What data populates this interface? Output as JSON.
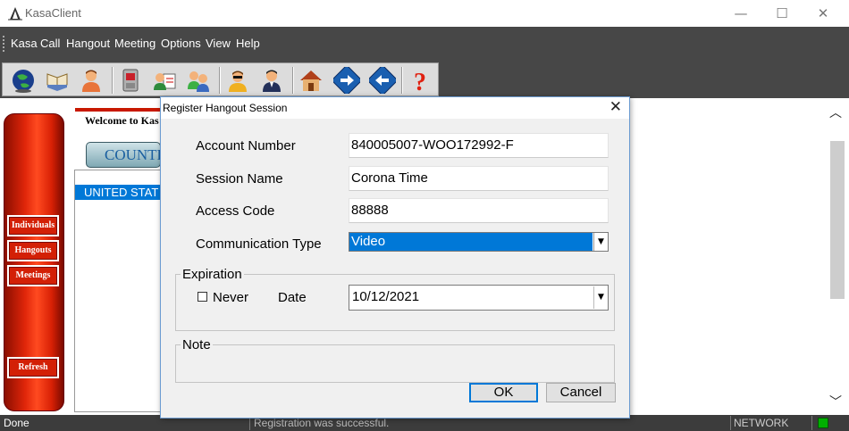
{
  "window": {
    "title": "KasaClient",
    "controls": {
      "minimize": "—",
      "maximize": "☐",
      "close": "✕"
    }
  },
  "menu": {
    "items": [
      "Kasa",
      "Call",
      "Hangout",
      "Meeting",
      "Options",
      "View",
      "Help"
    ]
  },
  "toolbar": {
    "icons": [
      "globe-icon",
      "book-icon",
      "person-icon",
      "phone-icon",
      "contact-icon",
      "group-icon",
      "user-sunglasses-icon",
      "user-suit-icon",
      "home-icon",
      "forward-arrow-icon",
      "back-arrow-icon",
      "help-icon"
    ]
  },
  "sidebar": {
    "buttons": [
      "Individuals",
      "Hangouts",
      "Meetings",
      "Refresh"
    ]
  },
  "main": {
    "welcome": "Welcome to Kas",
    "country_button": "COUNTRY",
    "country_selected": "UNITED STAT"
  },
  "status": {
    "left": "Done",
    "middle": "Registration was successful.",
    "network": "NETWORK",
    "network_color": "#00b000"
  },
  "dialog": {
    "title": "Register Hangout Session",
    "close": "✕",
    "account_label": "Account Number",
    "account_value": "840005007-WOO172992-F",
    "session_label": "Session Name",
    "session_value": "Corona Time",
    "access_label": "Access Code",
    "access_value": "88888",
    "comm_label": "Communication Type",
    "comm_value": "Video",
    "expiration_label": "Expiration",
    "never_label": "Never",
    "never_checked": false,
    "date_label": "Date",
    "date_value": "10/12/2021",
    "note_label": "Note",
    "ok": "OK",
    "cancel": "Cancel"
  }
}
